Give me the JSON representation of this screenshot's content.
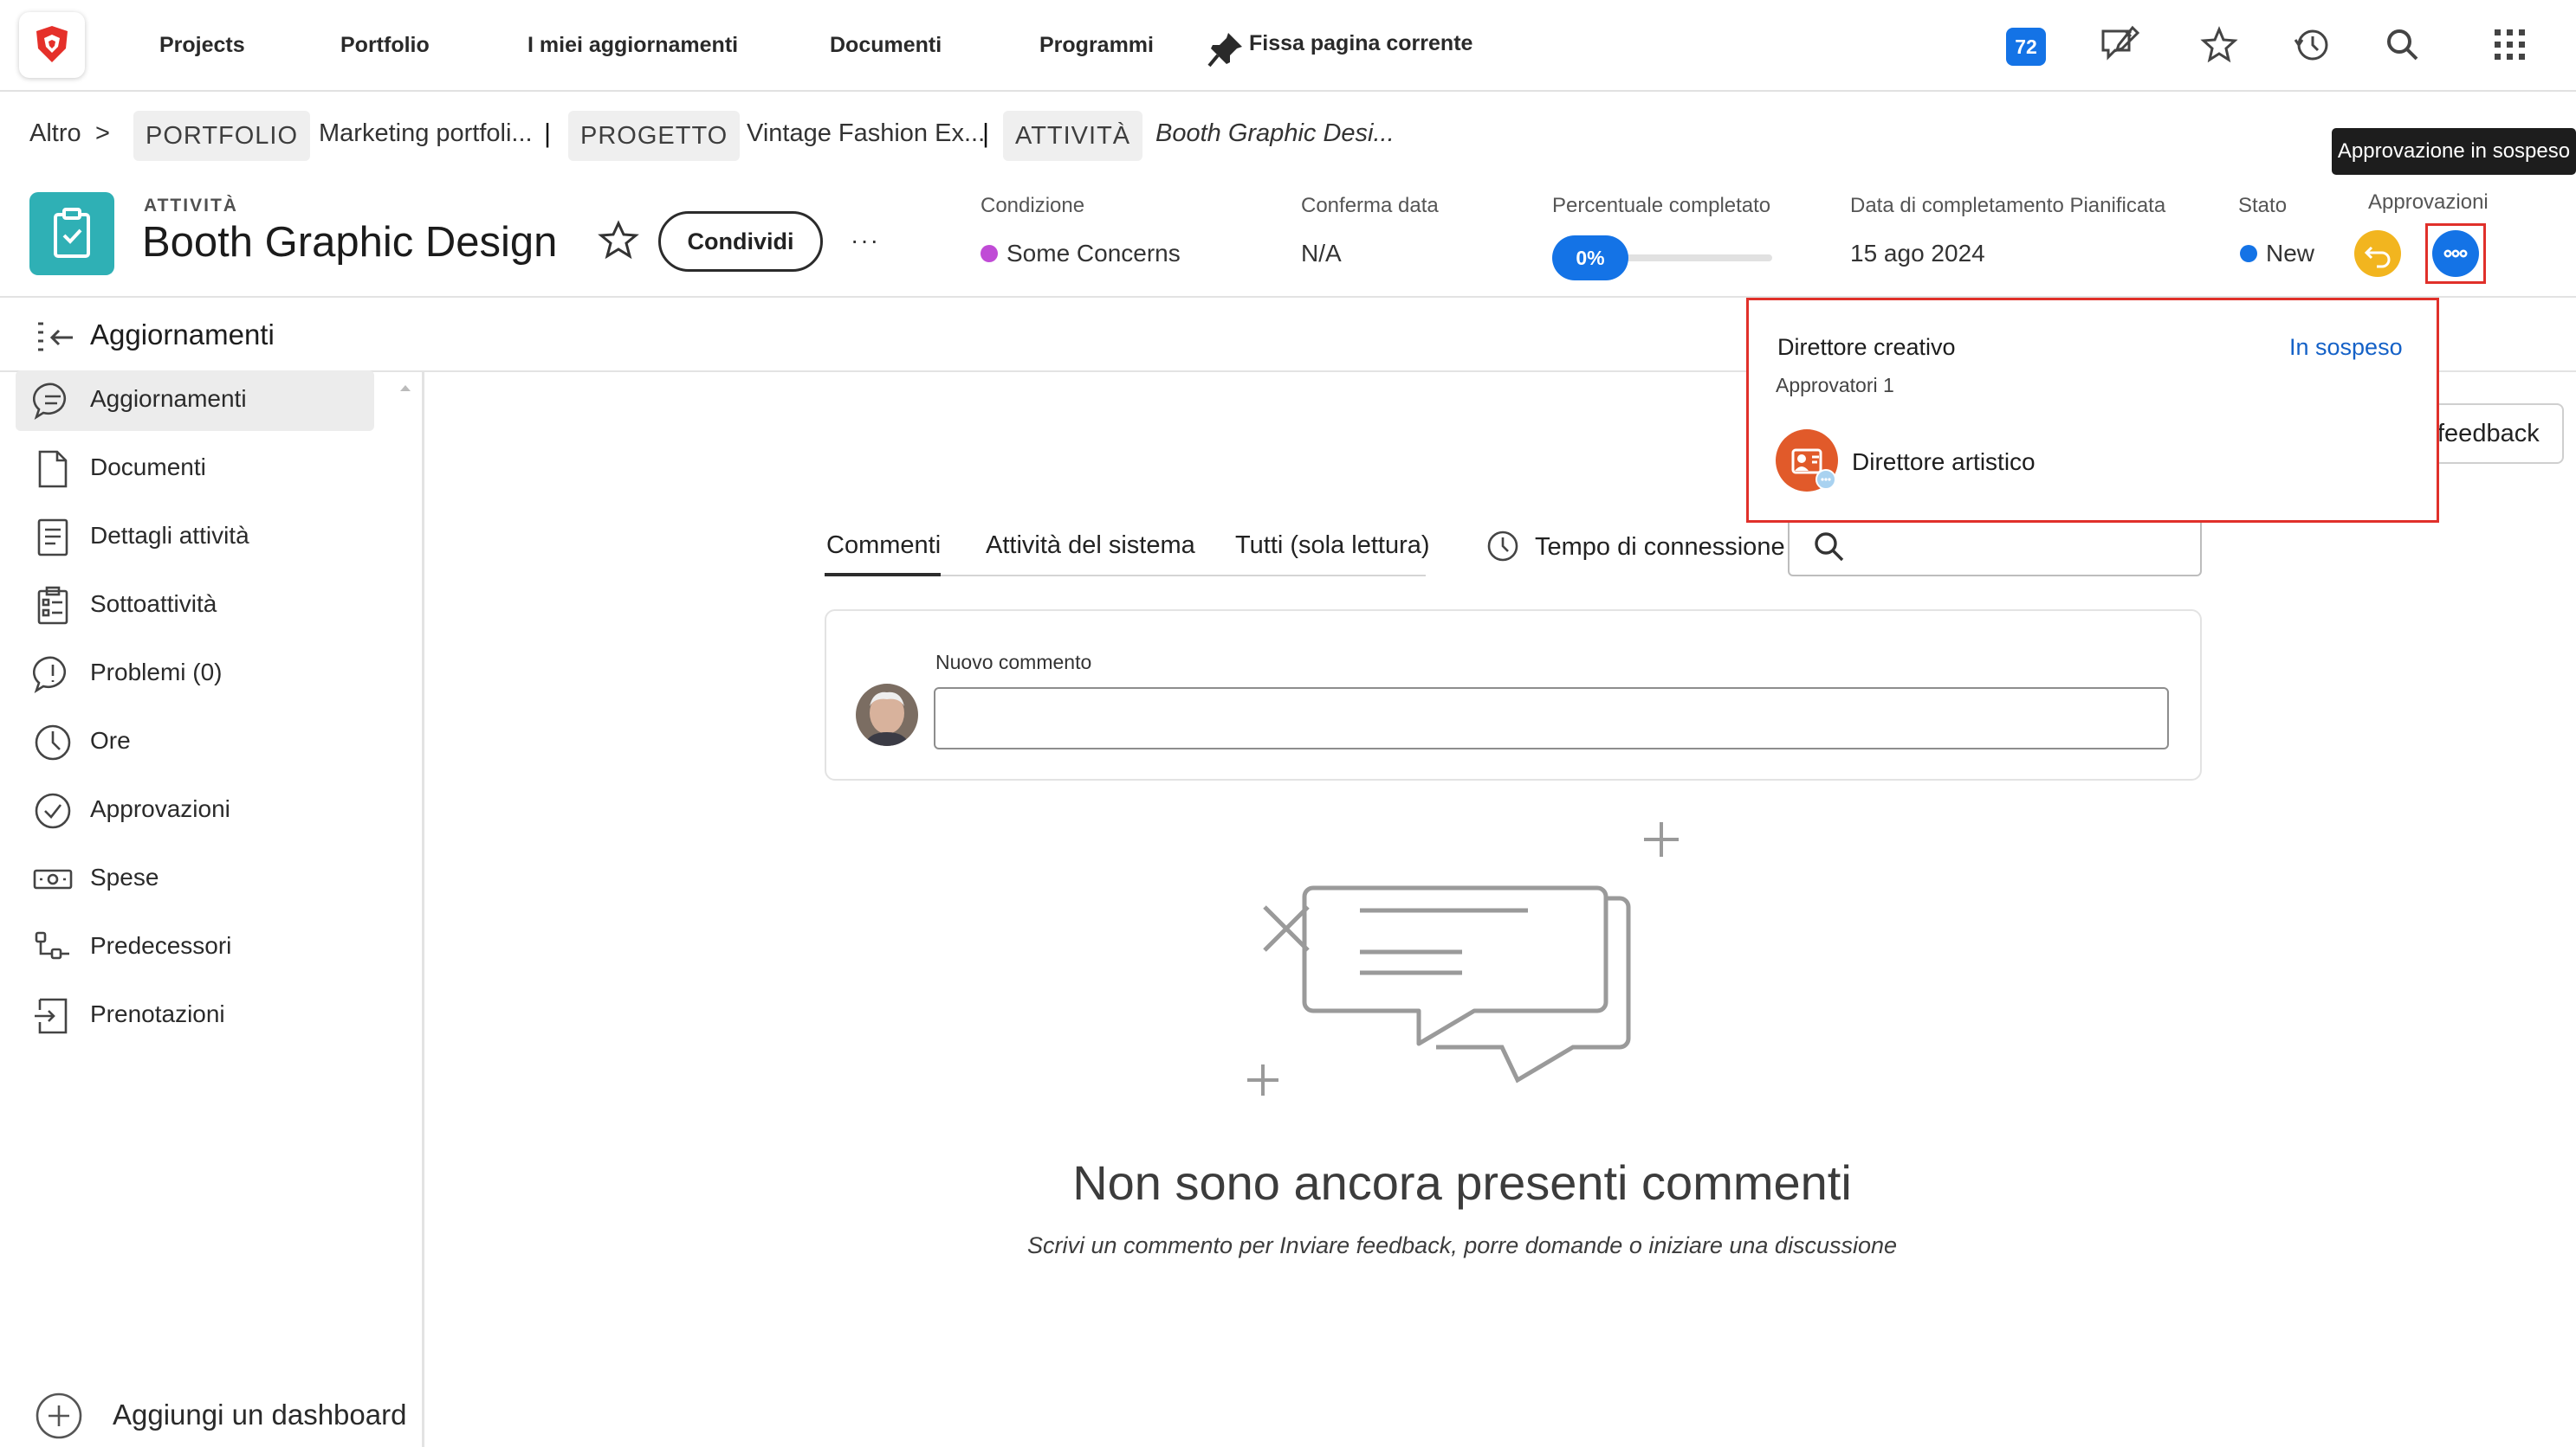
{
  "nav": {
    "links": [
      "Projects",
      "Portfolio",
      "I miei aggiornamenti",
      "Documenti",
      "Programmi"
    ],
    "pin_label": "Fissa pagina corrente",
    "notification_count": "72",
    "icons": [
      "logo-icon",
      "pin-icon",
      "feedback-icon",
      "star-icon",
      "history-icon",
      "search-icon",
      "apps-grid-icon"
    ]
  },
  "breadcrumb": {
    "more": "Altro",
    "more_sep": ">",
    "sep": "|",
    "portfolio_tag": "PORTFOLIO",
    "portfolio_name": "Marketing portfoli...",
    "project_tag": "PROGETTO",
    "project_name": "Vintage Fashion Ex...",
    "task_tag": "ATTIVITÀ",
    "task_name": "Booth Graphic Desi..."
  },
  "tooltip": "Approvazione in sospeso",
  "header": {
    "type": "ATTIVITÀ",
    "title": "Booth Graphic Design",
    "share_label": "Condividi",
    "more_label": "···",
    "condition_label": "Condizione",
    "condition_value": "Some Concerns",
    "condition_color": "#c04bd6",
    "commit_label": "Conferma data",
    "commit_value": "N/A",
    "percent_label": "Percentuale completato",
    "percent_value": "0%",
    "percent_complete": 0,
    "planned_label": "Data di completamento Pianificata",
    "planned_value": "15 ago 2024",
    "status_label": "Stato",
    "status_value": "New",
    "status_color": "#1473e6",
    "approvals_label": "Approvazioni",
    "approval_colors": [
      "#f2b51f",
      "#1473e6"
    ]
  },
  "updates": {
    "title": "Aggiornamenti"
  },
  "sidebar": {
    "items": [
      {
        "label": "Aggiornamenti",
        "icon": "comment-icon"
      },
      {
        "label": "Documenti",
        "icon": "document-icon"
      },
      {
        "label": "Dettagli attività",
        "icon": "details-icon"
      },
      {
        "label": "Sottoattività",
        "icon": "subtasks-icon"
      },
      {
        "label": "Problemi (0)",
        "icon": "issues-icon"
      },
      {
        "label": "Ore",
        "icon": "clock-icon"
      },
      {
        "label": "Approvazioni",
        "icon": "approval-check-icon"
      },
      {
        "label": "Spese",
        "icon": "expenses-icon"
      },
      {
        "label": "Predecessori",
        "icon": "predecessors-icon"
      },
      {
        "label": "Prenotazioni",
        "icon": "bookings-icon"
      }
    ],
    "add_dashboard": "Aggiungi un dashboard"
  },
  "tabs": {
    "comments": "Commenti",
    "system": "Attività del sistema",
    "all": "Tutti (sola lettura)",
    "time": "Tempo di connessione"
  },
  "comment": {
    "label": "Nuovo commento",
    "input_value": ""
  },
  "empty": {
    "title": "Non sono ancora presenti commenti",
    "subtitle": "Scrivi un commento per Inviare feedback, porre domande o iniziare una discussione"
  },
  "feedback_btn": "feedback",
  "popover": {
    "title": "Direttore creativo",
    "status": "In sospeso",
    "approvers": "Approvatori 1",
    "person": "Direttore artistico"
  }
}
